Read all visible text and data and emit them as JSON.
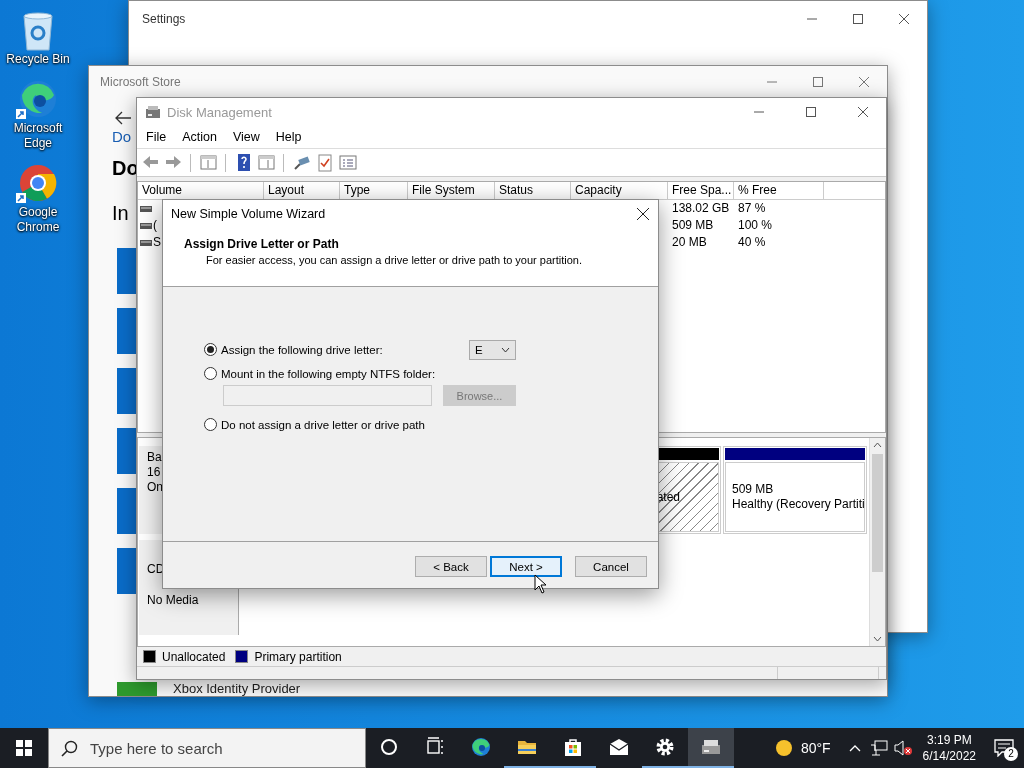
{
  "desktop_icons": [
    {
      "kind": "recycle_bin",
      "label": "Recycle Bin"
    },
    {
      "kind": "edge",
      "label": "Microsoft Edge"
    },
    {
      "kind": "chrome",
      "label": "Google Chrome"
    }
  ],
  "settings_window": {
    "title": "Settings"
  },
  "store_window": {
    "title": "Microsoft Store",
    "link": "Do",
    "heading": "Do",
    "section": "In",
    "list_item": "Xbox Identity Provider"
  },
  "disk_management": {
    "title": "Disk Management",
    "menu": [
      "File",
      "Action",
      "View",
      "Help"
    ],
    "volume_table": {
      "columns": [
        "Volume",
        "Layout",
        "Type",
        "File System",
        "Status",
        "Capacity",
        "Free Spa...",
        "% Free"
      ],
      "rows": [
        {
          "free_space": "138.02 GB",
          "percent_free": "87 %"
        },
        {
          "volume": "(",
          "free_space": "509 MB",
          "percent_free": "100 %"
        },
        {
          "volume": "S",
          "free_space": "20 MB",
          "percent_free": "40 %"
        }
      ]
    },
    "disks": [
      {
        "kind": "basic",
        "label": [
          "Ba",
          "16",
          "On"
        ],
        "partitions": [
          {
            "kind": "unallocated",
            "text": [
              "ated"
            ]
          },
          {
            "kind": "primary",
            "text": [
              "509 MB",
              "Healthy (Recovery Partiti"
            ]
          }
        ]
      },
      {
        "kind": "cdrom",
        "label": [
          "CD",
          "No Media"
        ]
      }
    ],
    "legend": [
      {
        "label": "Unallocated",
        "color": "#000000"
      },
      {
        "label": "Primary partition",
        "color": "#000080"
      }
    ]
  },
  "wizard": {
    "title": "New Simple Volume Wizard",
    "heading": "Assign Drive Letter or Path",
    "description": "For easier access, you can assign a drive letter or drive path to your partition.",
    "options": [
      {
        "kind": "letter",
        "label": "Assign the following drive letter:",
        "selected": true,
        "value": "E"
      },
      {
        "kind": "folder",
        "label": "Mount in the following empty NTFS folder:",
        "selected": false,
        "button": "Browse...",
        "disabled": true
      },
      {
        "kind": "none",
        "label": "Do not assign a drive letter or drive path",
        "selected": false
      }
    ],
    "buttons": [
      {
        "label": "< Back",
        "focused": false
      },
      {
        "label": "Next >",
        "focused": true
      },
      {
        "label": "Cancel",
        "focused": false
      }
    ]
  },
  "taskbar": {
    "search_placeholder": "Type here to search",
    "apps": [
      {
        "kind": "cortana",
        "running": false,
        "selected": false
      },
      {
        "kind": "task_view",
        "running": false,
        "selected": false
      },
      {
        "kind": "edge",
        "running": false,
        "selected": false
      },
      {
        "kind": "folder",
        "running": true,
        "selected": false
      },
      {
        "kind": "store",
        "running": true,
        "selected": false
      },
      {
        "kind": "mail",
        "running": false,
        "selected": false
      },
      {
        "kind": "settings",
        "running": true,
        "selected": false
      },
      {
        "kind": "disk",
        "running": true,
        "selected": true
      }
    ],
    "weather": "80°F",
    "time": "3:19 PM",
    "date": "6/14/2022",
    "notifications": "2"
  }
}
